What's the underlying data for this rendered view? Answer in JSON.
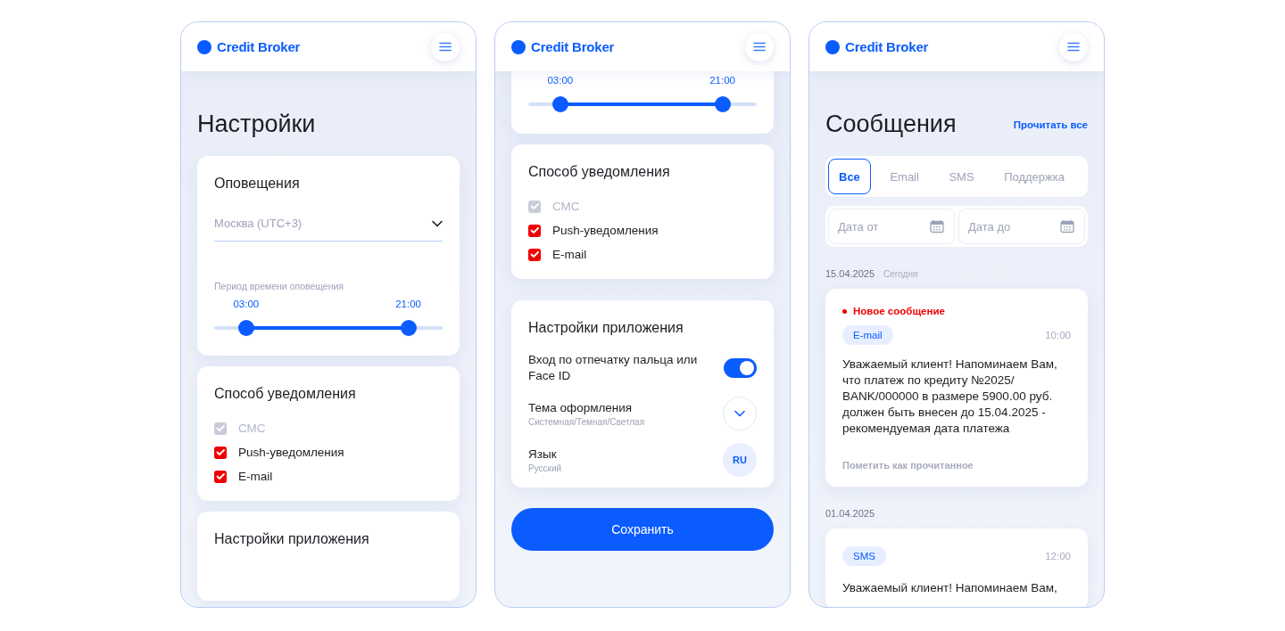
{
  "screens": [
    {
      "brand": "Credit Broker",
      "sections": [
        {
          "kind": "heading",
          "text": "Настройки"
        },
        {
          "kind": "alerts",
          "title": "Оповещения",
          "timezone": "Москва (UTC+3)",
          "period_label": "Период времени оповещения",
          "thumbs": [
            {
              "label": "03:00",
              "level": 0.14
            },
            {
              "label": "21:00",
              "level": 0.85
            }
          ]
        },
        {
          "kind": "methods",
          "title": "Способ уведомления",
          "options": [
            {
              "label": "СМС",
              "checked": true,
              "disabled": true
            },
            {
              "label": "Push-уведомления",
              "checked": true,
              "disabled": false
            },
            {
              "label": "E-mail",
              "checked": true,
              "disabled": false
            }
          ]
        },
        {
          "kind": "app",
          "title": "Настройки приложения"
        }
      ]
    },
    {
      "brand": "Credit Broker",
      "sections": [
        {
          "kind": "alerts",
          "thumbs": [
            {
              "label": "03:00",
              "level": 0.14
            },
            {
              "label": "21:00",
              "level": 0.85
            }
          ]
        },
        {
          "kind": "methods",
          "title": "Способ уведомления",
          "options": [
            {
              "label": "СМС",
              "checked": true,
              "disabled": true
            },
            {
              "label": "Push-уведомления",
              "checked": true,
              "disabled": false
            },
            {
              "label": "E-mail",
              "checked": true,
              "disabled": false
            }
          ]
        },
        {
          "kind": "app",
          "title": "Настройки приложения",
          "items": [
            {
              "kind": "toggle",
              "label": "Вход по отпечатку пальца или Face ID",
              "on": true
            },
            {
              "kind": "select",
              "label": "Тема оформления",
              "hint": "Системная/Темная/Светлая"
            },
            {
              "kind": "language",
              "label": "Язык",
              "hint": "Русский",
              "code": "RU"
            }
          ]
        },
        {
          "kind": "button",
          "label": "Сохранить"
        }
      ]
    },
    {
      "brand": "Credit Broker",
      "sections": [
        {
          "kind": "heading",
          "text": "Сообщения",
          "action": "Прочитать все"
        },
        {
          "kind": "tabs",
          "tabs": [
            {
              "label": "Все",
              "selected": true
            },
            {
              "label": "Email",
              "selected": false
            },
            {
              "label": "SMS",
              "selected": false
            },
            {
              "label": "Поддержка",
              "selected": false
            }
          ]
        },
        {
          "kind": "dates",
          "fields": [
            {
              "placeholder": "Дата от"
            },
            {
              "placeholder": "Дата до"
            }
          ]
        },
        {
          "kind": "day",
          "date": "15.04.2025",
          "note": "Сегодня"
        },
        {
          "kind": "message",
          "new_label": "Новое сообщение",
          "tag": "E-mail",
          "time": "10:00",
          "text": "Уважаемый клиент! Напоминаем Вам, что платеж по кредиту №2025/ BANK/000000 в размере 5900.00 руб. должен быть внесен до 15.04.2025 - рекомендуемая дата платежа",
          "action": "Пометить как прочитанное"
        },
        {
          "kind": "day",
          "date": "01.04.2025"
        },
        {
          "kind": "message",
          "tag": "SMS",
          "time": "12:00",
          "text": "Уважаемый клиент! Напоминаем Вам,"
        }
      ]
    }
  ]
}
